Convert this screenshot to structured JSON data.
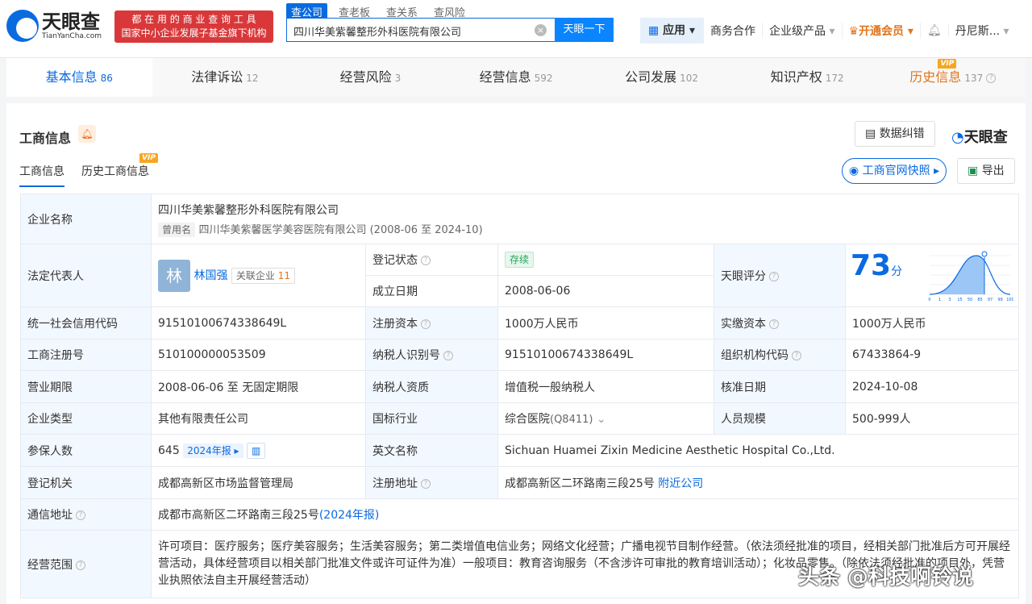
{
  "header": {
    "logo_cn": "天眼查",
    "logo_en": "TianYanCha.com",
    "slogan1": "都 在 用 的 商 业 查 询 工 具",
    "slogan2": "国家中小企业发展子基金旗下机构",
    "search_tabs": [
      "查公司",
      "查老板",
      "查关系",
      "查风险"
    ],
    "search_value": "四川华美紫馨整形外科医院有限公司",
    "search_button": "天眼一下",
    "nav": {
      "apps": "应用",
      "business": "商务合作",
      "enterprise": "企业级产品",
      "vip": "开通会员",
      "user": "丹尼斯..."
    }
  },
  "tabs": [
    {
      "label": "基本信息",
      "count": "86"
    },
    {
      "label": "法律诉讼",
      "count": "12"
    },
    {
      "label": "经营风险",
      "count": "3"
    },
    {
      "label": "经营信息",
      "count": "592"
    },
    {
      "label": "公司发展",
      "count": "102"
    },
    {
      "label": "知识产权",
      "count": "172"
    },
    {
      "label": "历史信息",
      "count": "137",
      "badge": "VIP"
    }
  ],
  "section": {
    "title": "工商信息",
    "correction": "数据纠错",
    "brand": "天眼查",
    "sub_tabs": [
      "工商信息",
      "历史工商信息"
    ],
    "vip": "VIP",
    "snapshot": "工商官网快照",
    "export": "导出"
  },
  "info": {
    "name_label": "企业名称",
    "name": "四川华美紫馨整形外科医院有限公司",
    "former_tag": "曾用名",
    "former": "四川华美紫馨医学美容医院有限公司 (2008-06 至 2024-10)",
    "rep_label": "法定代表人",
    "rep_avatar": "林",
    "rep": "林国强",
    "related": "关联企业",
    "related_count": "11",
    "status_label": "登记状态",
    "status": "存续",
    "estab_label": "成立日期",
    "estab": "2008-06-06",
    "score_label": "天眼评分",
    "score": "73",
    "score_unit": "分",
    "score_ticks": [
      "0",
      "1",
      "3",
      "15",
      "50",
      "85",
      "97",
      "99",
      "100"
    ],
    "credit_label": "统一社会信用代码",
    "credit": "91510100674338649L",
    "capital_label": "注册资本",
    "capital": "1000万人民币",
    "paid_label": "实缴资本",
    "paid": "1000万人民币",
    "reg_label": "工商注册号",
    "reg": "510100000053509",
    "tax_label": "纳税人识别号",
    "tax": "91510100674338649L",
    "org_label": "组织机构代码",
    "org": "67433864-9",
    "term_label": "营业期限",
    "term": "2008-06-06 至 无固定期限",
    "taxq_label": "纳税人资质",
    "taxq": "增值税一般纳税人",
    "approve_label": "核准日期",
    "approve": "2024-10-08",
    "type_label": "企业类型",
    "type": "其他有限责任公司",
    "industry_label": "国标行业",
    "industry": "综合医院",
    "industry_code": "(Q8411)",
    "staff_label": "人员规模",
    "staff": "500-999人",
    "insured_label": "参保人数",
    "insured": "645",
    "insured_year": "2024年报",
    "en_label": "英文名称",
    "en": "Sichuan Huamei Zixin Medicine Aesthetic Hospital Co.,Ltd.",
    "authority_label": "登记机关",
    "authority": "成都高新区市场监督管理局",
    "addr_label": "注册地址",
    "addr": "成都高新区二环路南三段25号",
    "nearby": "附近公司",
    "mail_label": "通信地址",
    "mail": "成都市高新区二环路南三段25号",
    "mail_year": "(2024年报)",
    "scope_label": "经营范围",
    "scope": "许可项目：医疗服务；医疗美容服务；生活美容服务；第二类增值电信业务；网络文化经营；广播电视节目制作经营。（依法须经批准的项目，经相关部门批准后方可开展经营活动，具体经营项目以相关部门批准文件或许可证件为准）一般项目：教育咨询服务（不含涉许可审批的教育培训活动）；化妆品零售。（除依法须经批准的项目外，凭营业执照依法自主开展经营活动）"
  },
  "watermark": "头条 @科技啊铃说"
}
